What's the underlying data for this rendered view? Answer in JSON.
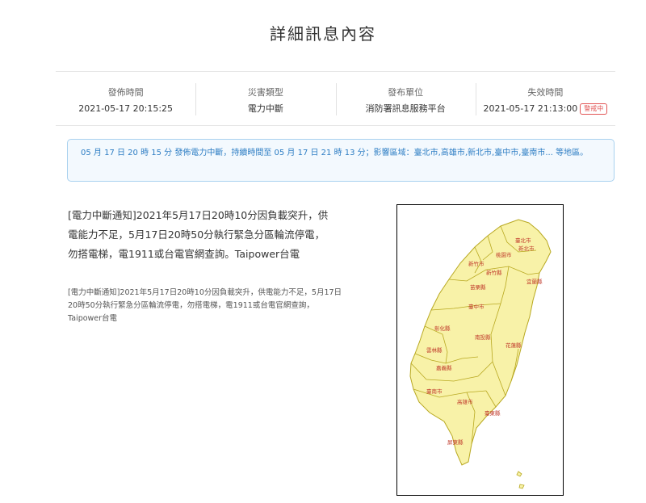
{
  "page": {
    "title": "詳細訊息內容"
  },
  "meta": [
    {
      "label": "發佈時間",
      "value": "2021-05-17 20:15:25"
    },
    {
      "label": "災害類型",
      "value": "電力中斷"
    },
    {
      "label": "發布單位",
      "value": "消防署訊息服務平台"
    },
    {
      "label": "失效時間",
      "value": "2021-05-17 21:13:00",
      "badge": "警戒中"
    }
  ],
  "summary": "05 月 17 日 20 時 15 分 發佈電力中斷，持續時間至 05 月 17 日 21 時 13 分；影響區域：臺北市,高雄市,新北市,臺中市,臺南市... 等地區。",
  "message": {
    "large": "[電力中斷通知]2021年5月17日20時10分因負載突升，供電能力不足，5月17日20時50分執行緊急分區輪流停電，勿搭電梯，電1911或台電官網查詢。Taipower台電",
    "small": "[電力中斷通知]2021年5月17日20時10分因負載突升，供電能力不足，5月17日20時50分執行緊急分區輪流停電，勿搭電梯，電1911或台電官網查詢，Taipower台電"
  },
  "map": {
    "fill_color": "#f8f2a8",
    "stroke_color": "#b8a820",
    "label_color": "#c0392b",
    "counties": [
      "臺北市",
      "新北市",
      "桃園市",
      "新竹市",
      "新竹縣",
      "苗栗縣",
      "宜蘭縣",
      "臺中市",
      "彰化縣",
      "南投縣",
      "花蓮縣",
      "雲林縣",
      "嘉義縣",
      "臺南市",
      "高雄市",
      "臺東縣",
      "屏東縣"
    ]
  }
}
